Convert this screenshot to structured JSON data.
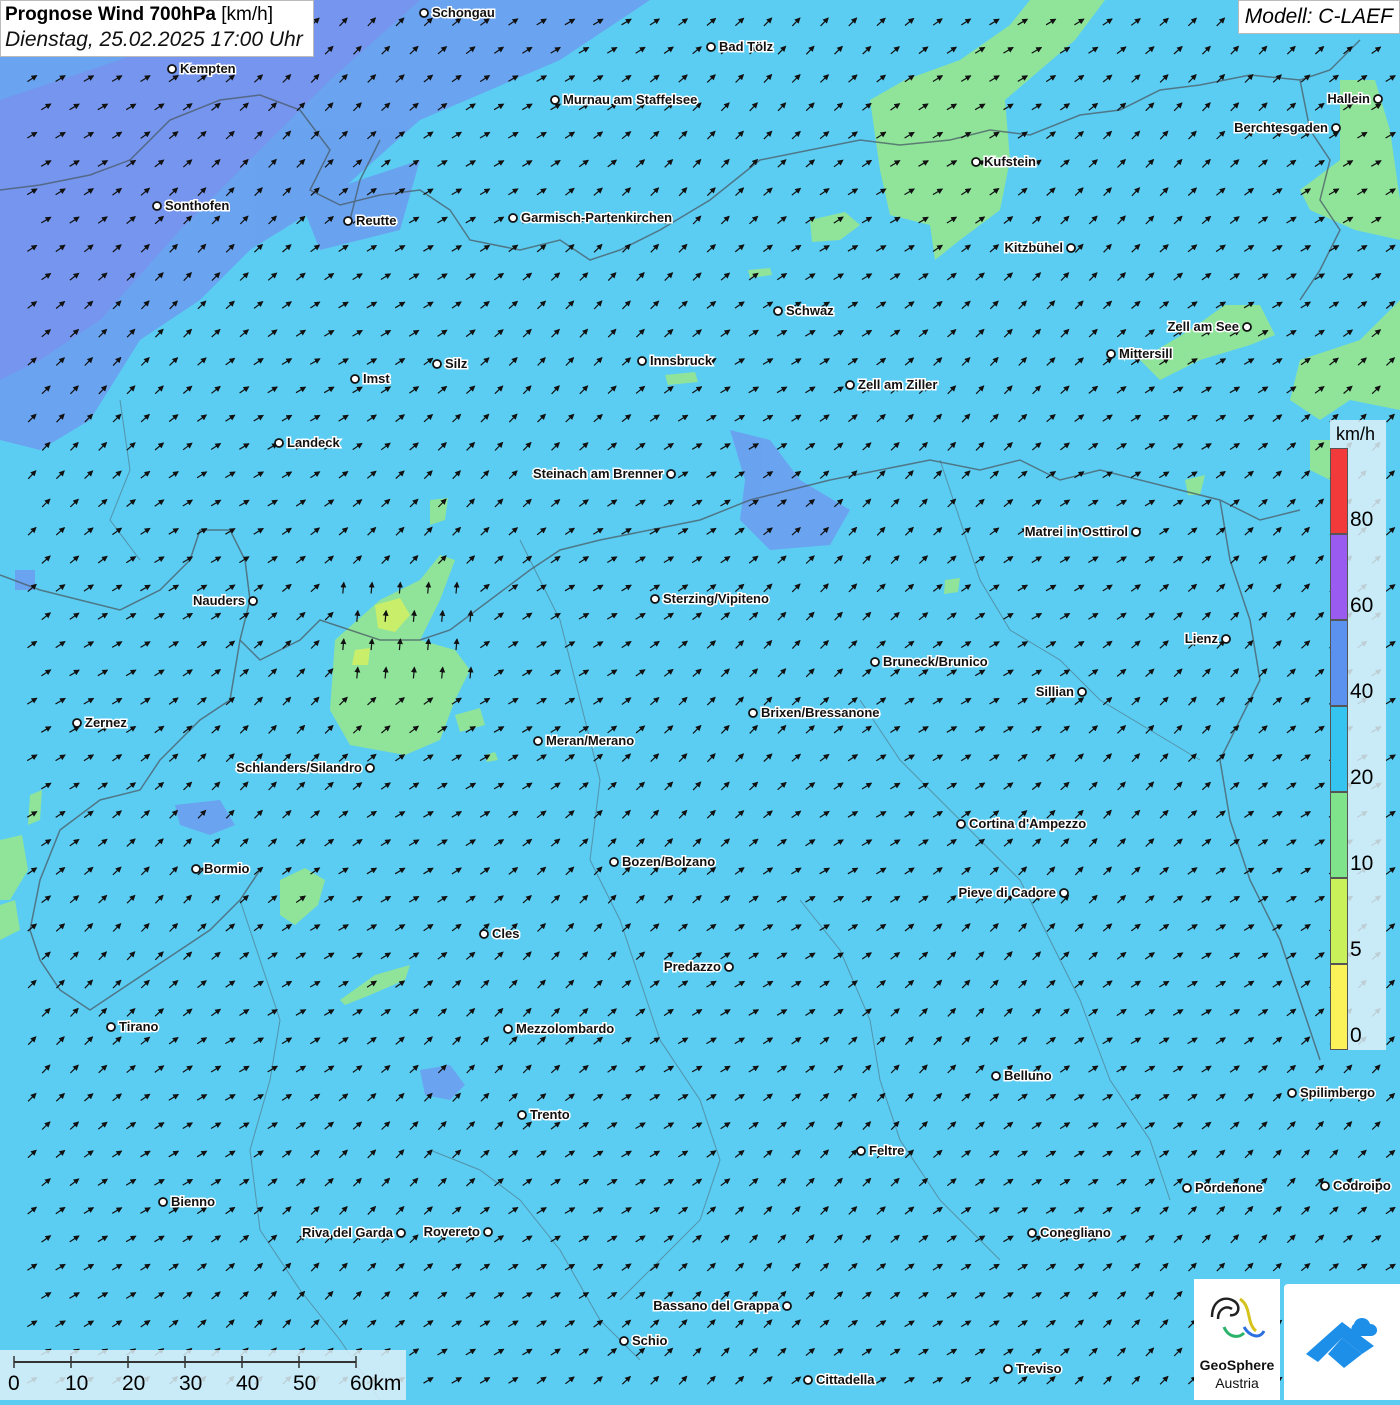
{
  "header": {
    "title_bold": "Prognose Wind 700hPa",
    "title_unit": "[km/h]",
    "datetime": "Dienstag, 25.02.2025 17:00 Uhr"
  },
  "model": "Modell: C-LAEF",
  "legend": {
    "unit": "km/h",
    "levels": [
      {
        "label": "0",
        "color": "#fbf25a"
      },
      {
        "label": "5",
        "color": "#c9f25a"
      },
      {
        "label": "10",
        "color": "#7fe38b"
      },
      {
        "label": "20",
        "color": "#35c4ef"
      },
      {
        "label": "40",
        "color": "#5c92ef"
      },
      {
        "label": "60",
        "color": "#9a5cf0"
      },
      {
        "label": "80",
        "color": "#f23a3a"
      }
    ]
  },
  "scale": {
    "labels": [
      "0",
      "10",
      "20",
      "30",
      "40",
      "50",
      "60km"
    ]
  },
  "logos": {
    "geosphere_line1": "GeoSphere",
    "geosphere_line2": "Austria"
  },
  "wind": {
    "prevailing_direction": "south-west to north-east",
    "arrow_icon": "wind-arrow-icon"
  },
  "cities": [
    {
      "name": "Schongau"
    },
    {
      "name": "Bad Tölz"
    },
    {
      "name": "Kempten"
    },
    {
      "name": "Murnau am Staffelsee"
    },
    {
      "name": "Hallein"
    },
    {
      "name": "Berchtesgaden"
    },
    {
      "name": "Kufstein"
    },
    {
      "name": "Sonthofen"
    },
    {
      "name": "Reutte"
    },
    {
      "name": "Garmisch-Partenkirchen"
    },
    {
      "name": "Kitzbühel"
    },
    {
      "name": "Schwaz"
    },
    {
      "name": "Zell am See"
    },
    {
      "name": "Mittersill"
    },
    {
      "name": "Innsbruck"
    },
    {
      "name": "Silz"
    },
    {
      "name": "Imst"
    },
    {
      "name": "Zell am Ziller"
    },
    {
      "name": "Landeck"
    },
    {
      "name": "Steinach am Brenner"
    },
    {
      "name": "Matrei in Osttirol"
    },
    {
      "name": "Nauders"
    },
    {
      "name": "Sterzing/Vipiteno"
    },
    {
      "name": "Lienz"
    },
    {
      "name": "Bruneck/Brunico"
    },
    {
      "name": "Sillian"
    },
    {
      "name": "Zernez"
    },
    {
      "name": "Brixen/Bressanone"
    },
    {
      "name": "Meran/Merano"
    },
    {
      "name": "Schlanders/Silandro"
    },
    {
      "name": "Cortina d'Ampezzo"
    },
    {
      "name": "Bozen/Bolzano"
    },
    {
      "name": "Bormio"
    },
    {
      "name": "Pieve di Cadore"
    },
    {
      "name": "Cles"
    },
    {
      "name": "Predazzo"
    },
    {
      "name": "Tirano"
    },
    {
      "name": "Mezzolombardo"
    },
    {
      "name": "Belluno"
    },
    {
      "name": "Spilimbergo"
    },
    {
      "name": "Trento"
    },
    {
      "name": "Feltre"
    },
    {
      "name": "Pordenone"
    },
    {
      "name": "Codroipo"
    },
    {
      "name": "Bienno"
    },
    {
      "name": "Riva del Garda"
    },
    {
      "name": "Rovereto"
    },
    {
      "name": "Conegliano"
    },
    {
      "name": "Bassano del Grappa"
    },
    {
      "name": "Schio"
    },
    {
      "name": "Treviso"
    },
    {
      "name": "Cittadella"
    }
  ]
}
